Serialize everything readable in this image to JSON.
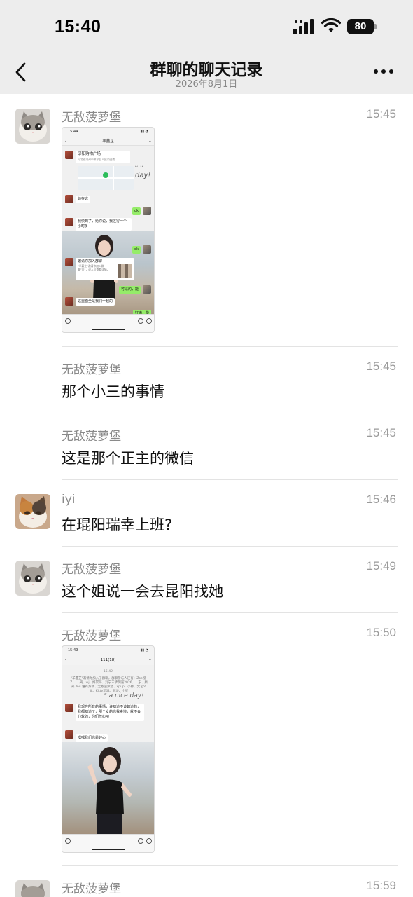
{
  "status_bar": {
    "time": "15:40",
    "battery": "80"
  },
  "nav": {
    "title": "群聊的聊天记录",
    "subtitle": "2026年8月1日"
  },
  "messages": [
    {
      "sender": "无敌菠萝堡",
      "time": "15:45",
      "type": "image"
    },
    {
      "sender": "无敌菠萝堡",
      "time": "15:45",
      "text": "那个小三的事情"
    },
    {
      "sender": "无敌菠萝堡",
      "time": "15:45",
      "text": "这是那个正主的微信"
    },
    {
      "sender": "iyi",
      "time": "15:46",
      "text": "在琨阳瑞幸上班?"
    },
    {
      "sender": "无敌菠萝堡",
      "time": "15:49",
      "text": "这个姐说一会去昆阳找她"
    },
    {
      "sender": "无敌菠萝堡",
      "time": "15:50",
      "type": "image"
    },
    {
      "sender": "无敌菠萝堡",
      "time": "15:59"
    }
  ],
  "thumb1": {
    "status_time": "15:44",
    "title": "羊蔓芷",
    "location_name": "邸阳购物广场",
    "location_addr": "河北省沧州市肃宁县人民公园南",
    "msg_here": "她在这",
    "ok": "ok",
    "msg_arrived": "我快到了，给你说，我还得一个小时多",
    "invite_title": "邀请你加入群聊",
    "invite_body": "\"羊蔓芷\"邀请你加入群聊\"??\"，进入可查看详情。",
    "reply1": "可以的，能",
    "msg_all": "这里面全是我们一起的",
    "reply2": "好滴，能"
  },
  "thumb2": {
    "status_time": "15:49",
    "title": "111(18)",
    "sys_time": "15:42",
    "sys_msg": "\"羊蔓芷\"邀请你加入了群聊，群聊参与人还有：Zoe橙-Z、.…哭、wj、好累呀、刘宁三梦倒逆2026、.. 东、原来 You 谁有苏我、无敌菠萝堡、xpup、小卿、文艺么文、Kitty滔滔、旧淡、小星",
    "msg1": "我现在所有的事情，诶知道不该如道的，我都知道了，那个女的也我卖惨，就不会心软的，你们放心吧",
    "msg2": "嘿嘿我们也是好心"
  }
}
